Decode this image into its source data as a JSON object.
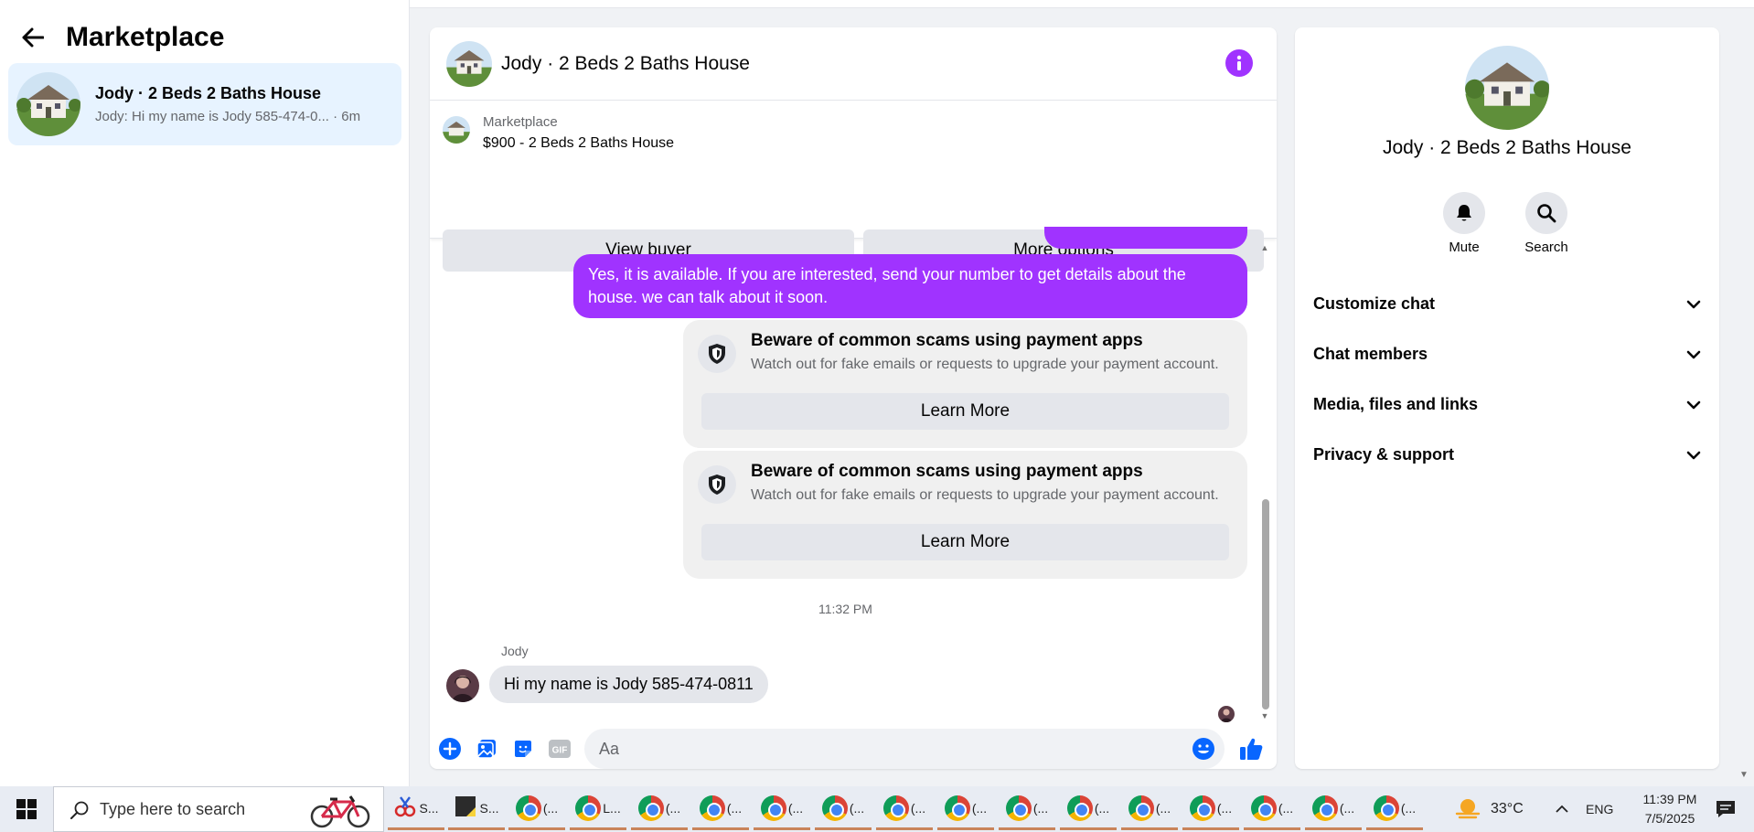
{
  "sidebar": {
    "title": "Marketplace",
    "conversation": {
      "name": "Jody · 2 Beds 2 Baths House",
      "preview": "Jody: Hi my name is Jody 585-474-0...",
      "time": "· 6m"
    }
  },
  "chat": {
    "title": "Jody · 2 Beds 2 Baths House",
    "listing": {
      "category": "Marketplace",
      "price_title": "$900 - 2 Beds 2 Baths House",
      "view_buyer_label": "View buyer",
      "more_options_label": "More options"
    },
    "outgoing_message": "Yes, it is available. If you are interested, send your number to get details about the house. we can talk about it soon.",
    "scam_notices": [
      {
        "title": "Beware of common scams using payment apps",
        "text": "Watch out for fake emails or requests to upgrade your payment account.",
        "button": "Learn More"
      },
      {
        "title": "Beware of common scams using payment apps",
        "text": "Watch out for fake emails or requests to upgrade your payment account.",
        "button": "Learn More"
      }
    ],
    "timestamp": "11:32 PM",
    "incoming": {
      "sender": "Jody",
      "message": "Hi my name is Jody 585-474-0811"
    },
    "composer": {
      "placeholder": "Aa",
      "gif_label": "GIF"
    }
  },
  "details": {
    "name": "Jody · 2 Beds 2 Baths House",
    "actions": [
      {
        "label": "Mute",
        "icon": "bell-icon"
      },
      {
        "label": "Search",
        "icon": "search-icon"
      }
    ],
    "sections": [
      "Customize chat",
      "Chat members",
      "Media, files and links",
      "Privacy & support"
    ]
  },
  "taskbar": {
    "search_placeholder": "Type here to search",
    "apps": [
      {
        "label": "S...",
        "icon": "snipping-tool-icon"
      },
      {
        "label": "S...",
        "icon": "sticky-notes-icon"
      },
      {
        "label": "(...",
        "icon": "chrome-icon"
      },
      {
        "label": "L...",
        "icon": "chrome-icon"
      },
      {
        "label": "(...",
        "icon": "chrome-icon"
      },
      {
        "label": "(...",
        "icon": "chrome-icon"
      },
      {
        "label": "(...",
        "icon": "chrome-icon"
      },
      {
        "label": "(...",
        "icon": "chrome-icon"
      },
      {
        "label": "(...",
        "icon": "chrome-icon"
      },
      {
        "label": "(...",
        "icon": "chrome-icon"
      },
      {
        "label": "(...",
        "icon": "chrome-icon"
      },
      {
        "label": "(...",
        "icon": "chrome-icon"
      },
      {
        "label": "(...",
        "icon": "chrome-icon"
      },
      {
        "label": "(...",
        "icon": "chrome-icon"
      },
      {
        "label": "(...",
        "icon": "chrome-icon"
      },
      {
        "label": "(...",
        "icon": "chrome-icon"
      },
      {
        "label": "(...",
        "icon": "chrome-icon"
      }
    ],
    "weather": "33°C",
    "language": "ENG",
    "time": "11:39 PM",
    "date": "7/5/2025"
  },
  "colors": {
    "accent": "#a033ff",
    "blue": "#0866ff",
    "selected_bg": "#e7f3ff"
  }
}
